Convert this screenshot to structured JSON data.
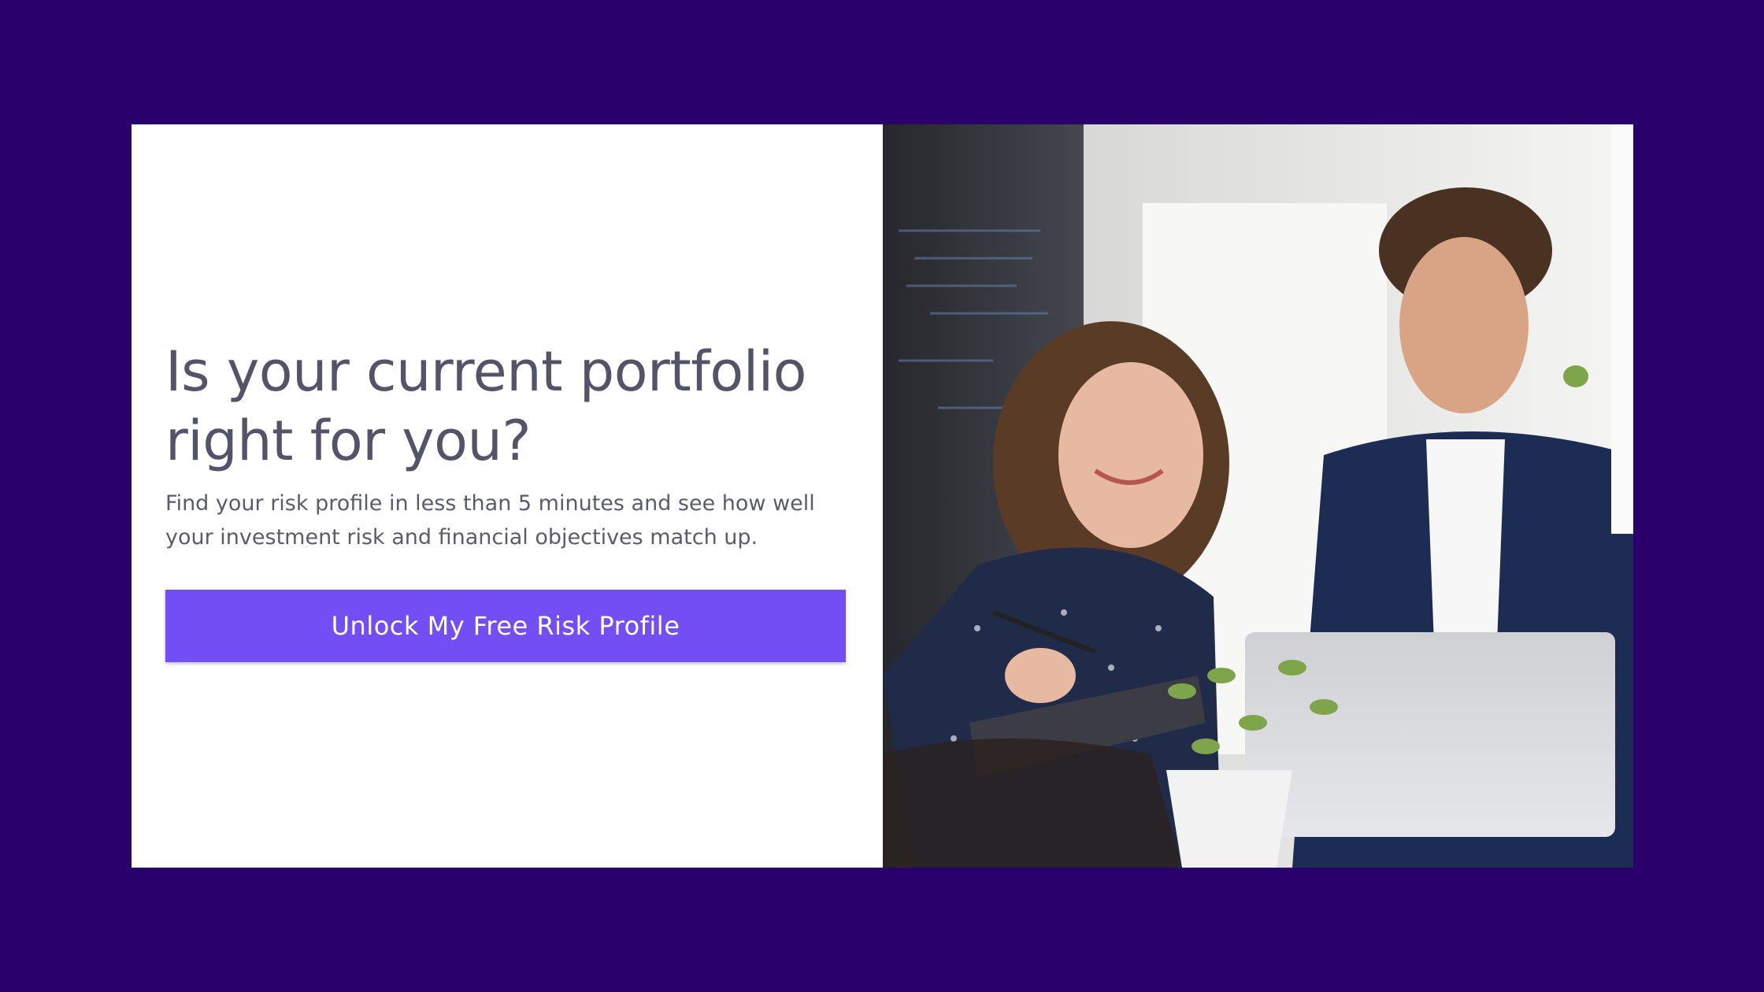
{
  "hero": {
    "headline": "Is your current portfolio right for you?",
    "subtext": "Find your risk profile in less than 5 minutes and see how well your investment risk and financial objectives match up.",
    "cta_label": "Unlock My Free Risk Profile"
  },
  "photo": {
    "icon": "photo-of-two-people-at-laptop"
  },
  "colors": {
    "page_background": "#2a006b",
    "card_background": "#ffffff",
    "headline": "#545468",
    "body_text": "#5b5b6b",
    "cta_background": "#724ff5",
    "cta_text": "#ffffff"
  }
}
